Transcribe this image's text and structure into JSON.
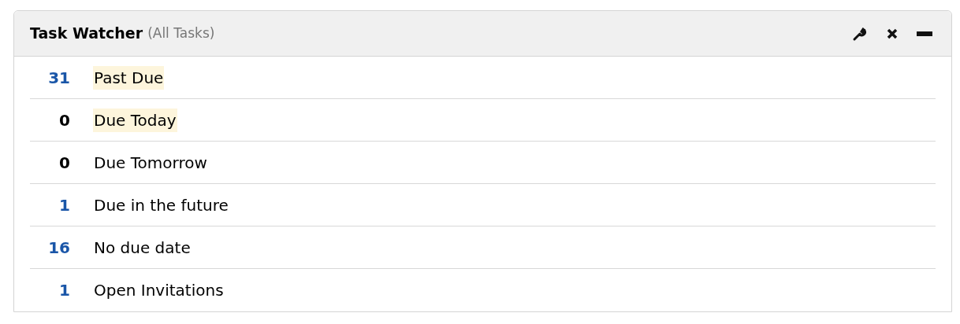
{
  "widget": {
    "title": "Task Watcher",
    "subtitle": "(All Tasks)"
  },
  "rows": [
    {
      "count": "31",
      "count_linked": true,
      "label": "Past Due",
      "highlighted": true
    },
    {
      "count": "0",
      "count_linked": false,
      "label": "Due Today",
      "highlighted": true
    },
    {
      "count": "0",
      "count_linked": false,
      "label": "Due Tomorrow",
      "highlighted": false
    },
    {
      "count": "1",
      "count_linked": true,
      "label": "Due in the future",
      "highlighted": false
    },
    {
      "count": "16",
      "count_linked": true,
      "label": "No due date",
      "highlighted": false
    },
    {
      "count": "1",
      "count_linked": true,
      "label": "Open Invitations",
      "highlighted": false
    }
  ]
}
